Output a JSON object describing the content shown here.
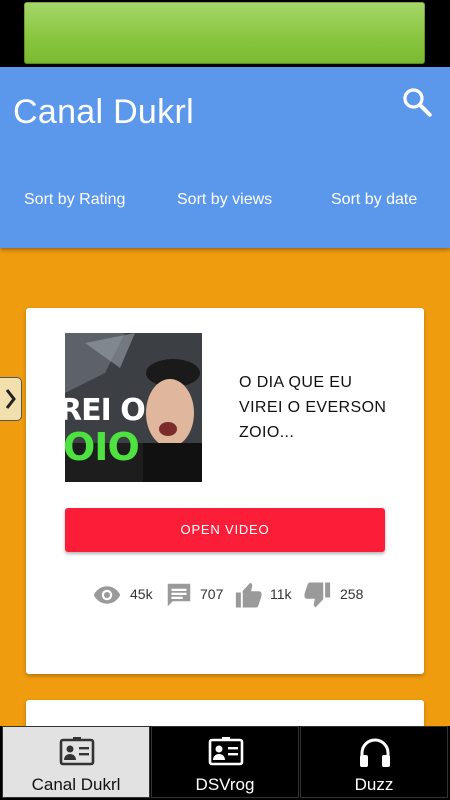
{
  "app": {
    "title": "Canal Dukrl",
    "search_icon": "search-icon"
  },
  "sort_options": [
    "Sort by Rating",
    "Sort by views",
    "Sort by date"
  ],
  "video": {
    "title": "O DIA QUE EU VIREI O EVERSON ZOIO...",
    "open_label": "OPEN VIDEO",
    "stats": {
      "views": "45k",
      "comments": "707",
      "likes": "11k",
      "dislikes": "258"
    },
    "thumbnail_text": [
      "REI O",
      "OIO"
    ]
  },
  "bottom_nav": [
    {
      "label": "Canal Dukrl",
      "icon": "contact-card-icon",
      "active": true
    },
    {
      "label": "DSVrog",
      "icon": "contact-card-icon",
      "active": false
    },
    {
      "label": "Duzz",
      "icon": "headphones-icon",
      "active": false
    }
  ],
  "colors": {
    "app_bar": "#5b98ec",
    "content_bg": "#f09c0f",
    "open_button": "#fc1e39",
    "ad_banner": "#8ac640"
  }
}
